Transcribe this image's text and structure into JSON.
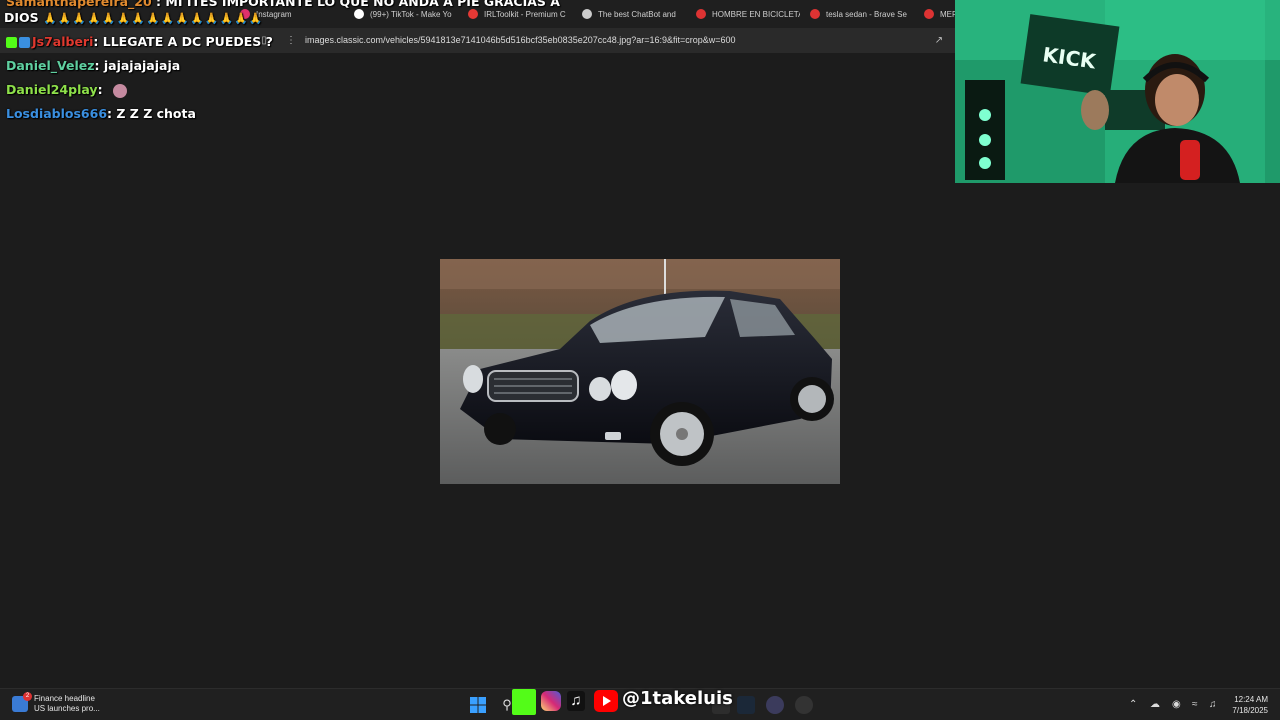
{
  "browser": {
    "tabs": [
      {
        "label": "Instagram",
        "color": "#e1306c"
      },
      {
        "label": "(99+) TikTok - Make Yo",
        "color": "#ffffff"
      },
      {
        "label": "IRLToolkit - Premium C",
        "color": "#e53935"
      },
      {
        "label": "The best ChatBot and",
        "color": "#cccccc"
      },
      {
        "label": "HOMBRE EN BICICLETA",
        "color": "#d33"
      },
      {
        "label": "tesla sedan - Brave Se",
        "color": "#d33"
      },
      {
        "label": "MERC",
        "color": "#d33"
      }
    ],
    "url": "images.classic.com/vehicles/5941813e7141046b5d516bcf35eb0835e207cc48.jpg?ar=16:9&fit=crop&w=600"
  },
  "chat": {
    "messages": [
      {
        "user": "Samanthapereira_20",
        "message": "MI ITES IMPORTANTE LO QUE NO ANDA A PIE GRACIAS A",
        "user_color": "#e08a2f"
      },
      {
        "user": "",
        "message": "DIOS",
        "user_color": "#ffffff"
      },
      {
        "user": "Js7alberi",
        "message": ": LLEGATE A DC PUEDES ?",
        "user_color": "#e0392f"
      },
      {
        "user": "Daniel_Velez",
        "message": ": jajajajajaja",
        "user_color": "#5fd0a0"
      },
      {
        "user": "Daniel24play",
        "message": ":",
        "user_color": "#8ee04a"
      },
      {
        "user": "Losdiablos666",
        "message": ": Z Z Z chota",
        "user_color": "#3a8fe0"
      }
    ]
  },
  "stream": {
    "handle": "@1takeluis",
    "webcam_sign": "KICK"
  },
  "taskbar": {
    "news_title": "Finance headline",
    "news_sub": "US launches pro...",
    "news_badge": "2",
    "time": "12:24 AM",
    "date": "7/18/2025"
  },
  "colors": {
    "kick_green": "#53fc18",
    "instagram": "#e1306c",
    "youtube": "#ff0000",
    "background": "#1c1c1c"
  }
}
